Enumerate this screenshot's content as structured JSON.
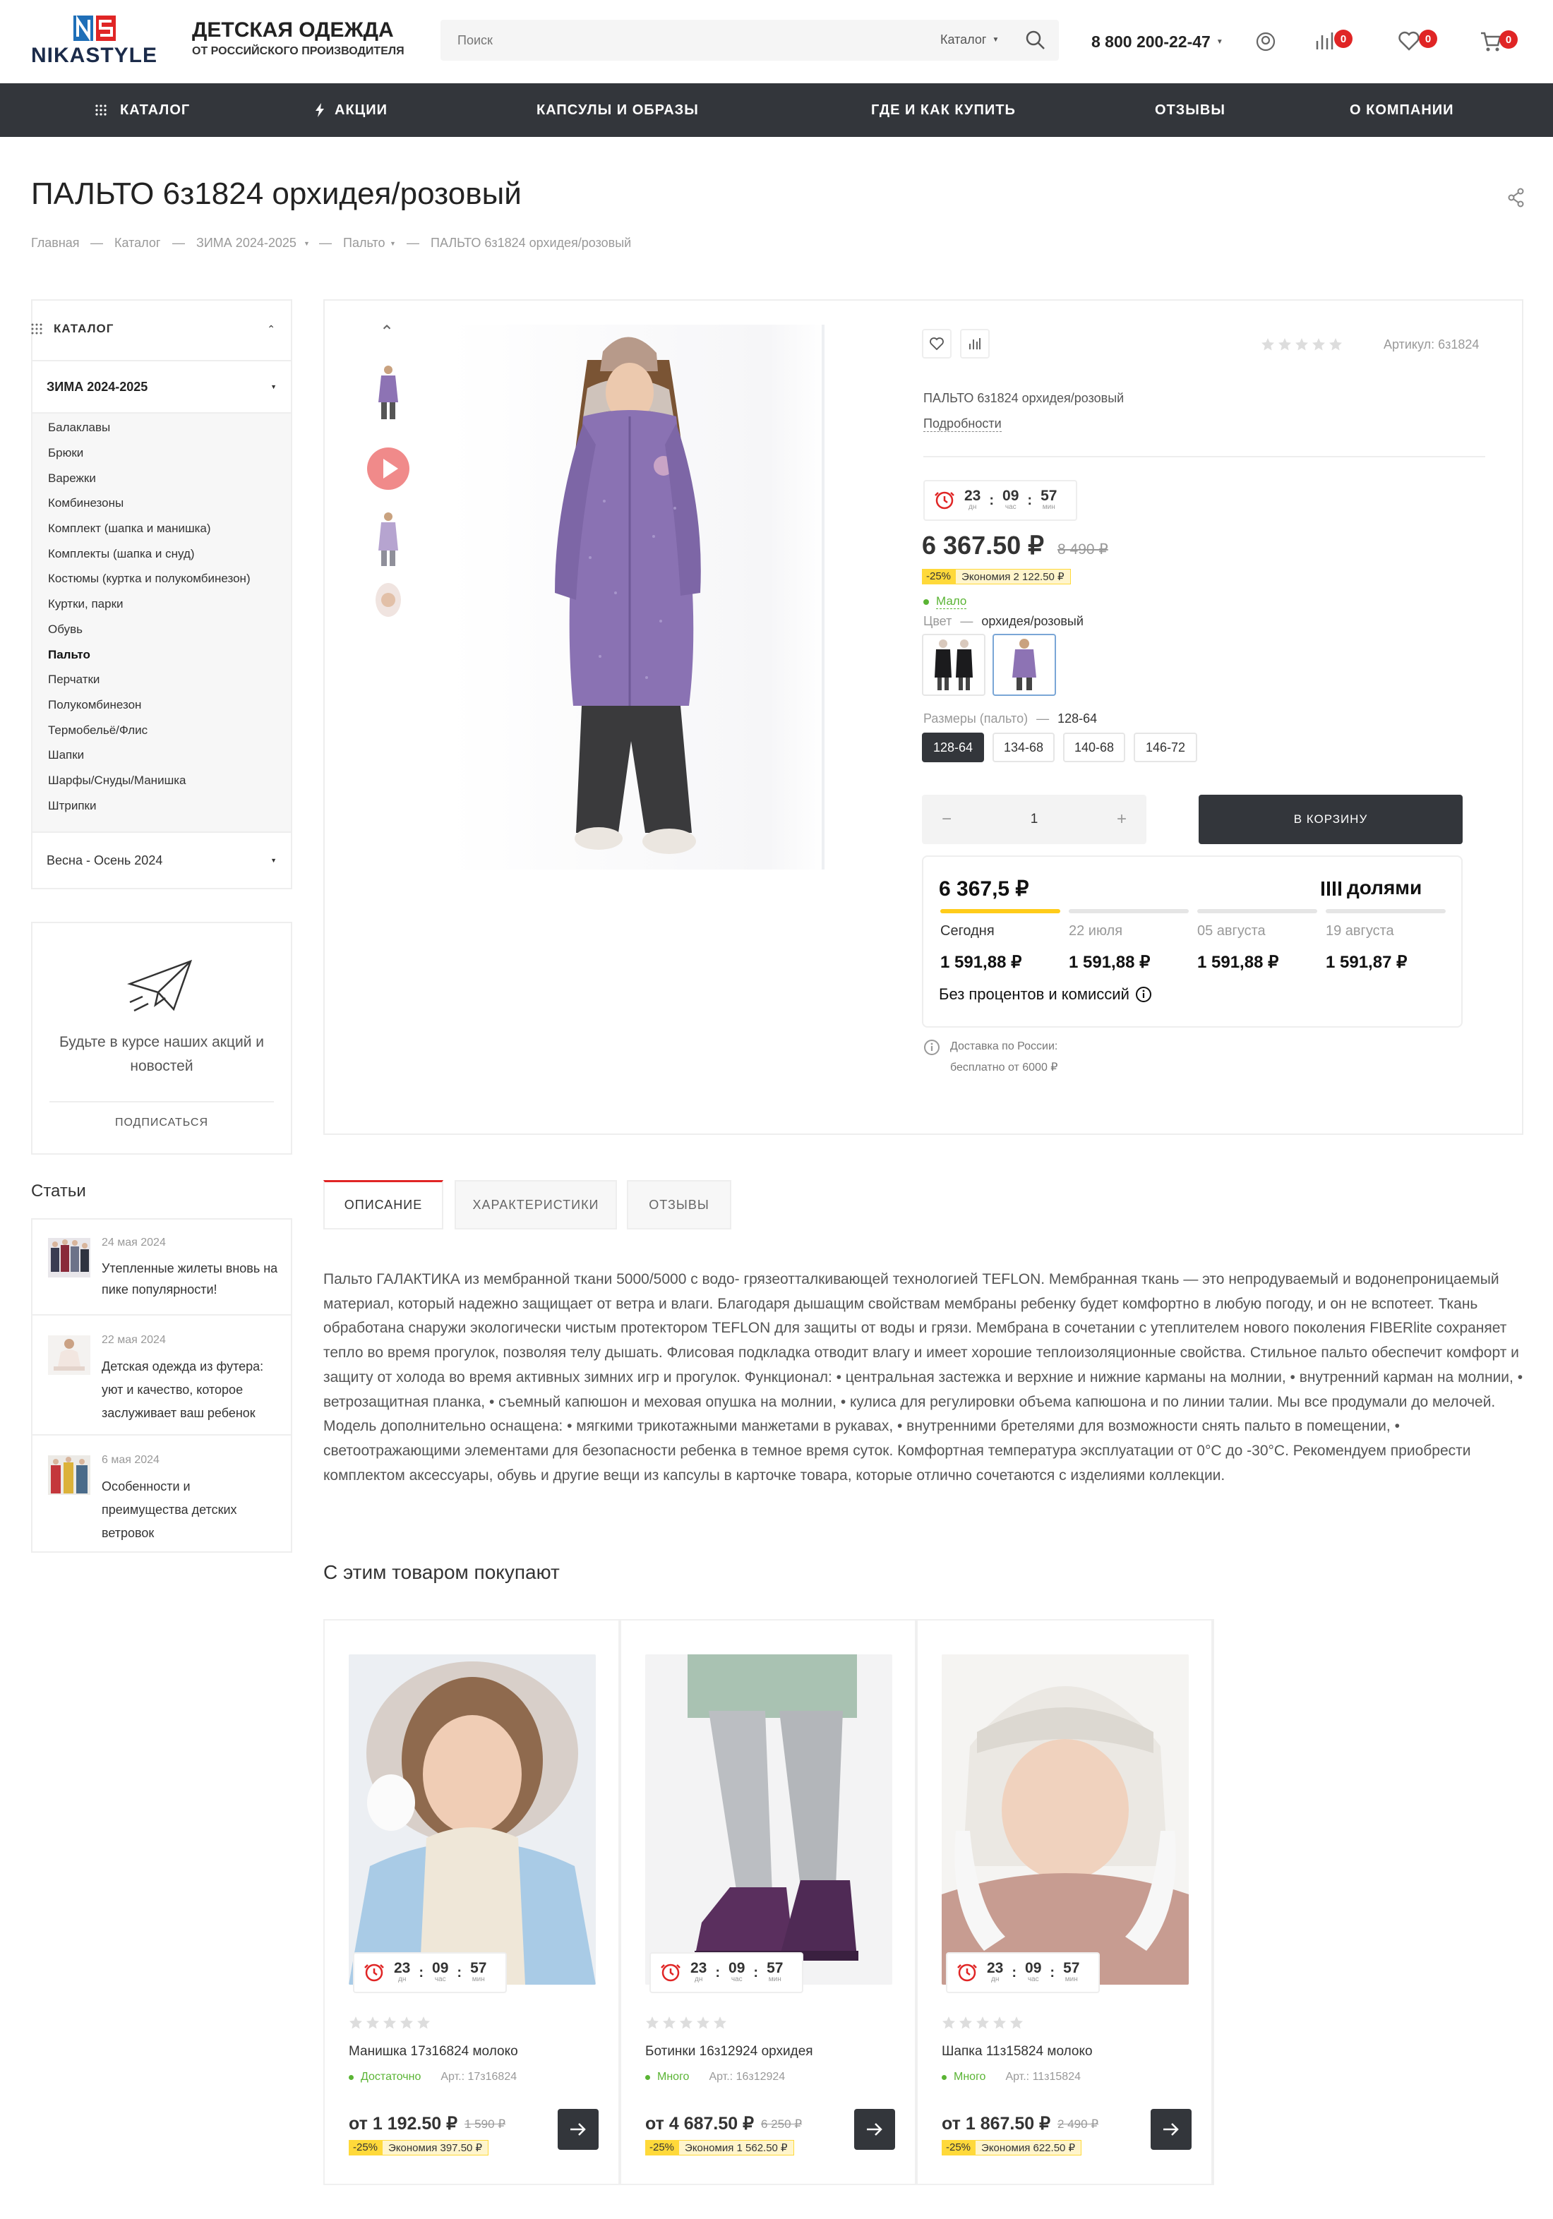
{
  "header": {
    "logo_text": "NIKASTYLE",
    "tagline_main": "ДЕТСКАЯ ОДЕЖДА",
    "tagline_sub": "ОТ РОССИЙСКОГО ПРОИЗВОДИТЕЛЯ",
    "search_placeholder": "Поиск",
    "search_scope": "Каталог",
    "phone": "8 800 200-22-47",
    "compare_count": "0",
    "favorites_count": "0",
    "cart_count": "0"
  },
  "nav": [
    "КАТАЛОГ",
    "АКЦИИ",
    "КАПСУЛЫ И ОБРАЗЫ",
    "ГДЕ И КАК КУПИТЬ",
    "ОТЗЫВЫ",
    "О КОМПАНИИ"
  ],
  "page_title": "ПАЛЬТО 6з1824 орхидея/розовый",
  "breadcrumbs": [
    "Главная",
    "Каталог",
    "ЗИМА 2024-2025",
    "Пальто",
    "ПАЛЬТО 6з1824 орхидея/розовый"
  ],
  "sidebar": {
    "catalog_title": "КАТАЛОГ",
    "section_open": "ЗИМА 2024-2025",
    "items": [
      "Балаклавы",
      "Брюки",
      "Варежки",
      "Комбинезоны",
      "Комплект (шапка и манишка)",
      "Комплекты (шапка и снуд)",
      "Костюмы (куртка и полукомбинезон)",
      "Куртки, парки",
      "Обувь",
      "Пальто",
      "Перчатки",
      "Полукомбинезон",
      "Термобельё/Флис",
      "Шапки",
      "Шарфы/Снуды/Манишка",
      "Штрипки"
    ],
    "active_item": "Пальто",
    "section_closed": "Весна - Осень 2024",
    "subscribe_text": "Будьте в курсе наших акций и новостей",
    "subscribe_button": "ПОДПИСАТЬСЯ",
    "articles_title": "Статьи",
    "articles": [
      {
        "date": "24 мая 2024",
        "title": "Утепленные жилеты вновь на пике популярности!"
      },
      {
        "date": "22 мая 2024",
        "title": "Детская одежда из футера: уют и качество, которое заслуживает ваш ребенок"
      },
      {
        "date": "6 мая 2024",
        "title": "Особенности и преимущества детских ветровок"
      }
    ]
  },
  "product": {
    "sku_label": "Артикул: 6з1824",
    "name_small": "ПАЛЬТО 6з1824 орхидея/розовый",
    "details_link": "Подробности",
    "timer": {
      "days": "23",
      "days_label": "дн",
      "hours": "09",
      "hours_label": "час",
      "mins": "57",
      "mins_label": "мин"
    },
    "price": "6 367.50 ₽",
    "old_price": "8 490 ₽",
    "discount": "-25%",
    "economy": "Экономия 2 122.50 ₽",
    "stock": "Мало",
    "color_label": "Цвет",
    "color_value": "орхидея/розовый",
    "size_label": "Размеры (пальто)",
    "size_value": "128-64",
    "sizes": [
      "128-64",
      "134-68",
      "140-68",
      "146-72"
    ],
    "qty": "1",
    "qty_minus": "−",
    "qty_plus": "+",
    "cart_button": "В КОРЗИНУ",
    "dolyami": {
      "total": "6 367,5 ₽",
      "brand": "долями",
      "payments": [
        {
          "date": "Сегодня",
          "sum": "1 591,88 ₽"
        },
        {
          "date": "22 июля",
          "sum": "1 591,88 ₽"
        },
        {
          "date": "05 августа",
          "sum": "1 591,88 ₽"
        },
        {
          "date": "19 августа",
          "sum": "1 591,87 ₽"
        }
      ],
      "note": "Без процентов и комиссий"
    },
    "delivery_line1": "Доставка по России:",
    "delivery_line2": "бесплатно от 6000 ₽"
  },
  "tabs": [
    "ОПИСАНИЕ",
    "ХАРАКТЕРИСТИКИ",
    "ОТЗЫВЫ"
  ],
  "description": "Пальто ГАЛАКТИКА из мембранной ткани 5000/5000 с водо- грязеотталкивающей технологией TEFLON. Мембранная ткань — это непродуваемый и водонепроницаемый материал, который надежно защищает от ветра и влаги. Благодаря дышащим свойствам мембраны ребенку будет комфортно в любую погоду, и он не вспотеет. Ткань обработана снаружи экологически чистым протектором TEFLON для защиты от воды и грязи. Мембрана в сочетании с утеплителем нового поколения FIBERlite сохраняет тепло во время прогулок, позволяя телу дышать. Флисовая подкладка отводит влагу и имеет хорошие теплоизоляционные свойства. Стильное пальто обеспечит комфорт и защиту от холода во время активных зимних игр и прогулок. Функционал: • центральная застежка и верхние и нижние карманы на молнии, • внутренний карман на молнии, • ветрозащитная планка, • съемный капюшон и меховая опушка на молнии, • кулиса для регулировки объема капюшона и по линии талии. Мы все продумали до мелочей. Модель дополнительно оснащена: • мягкими трикотажными манжетами в рукавах, • внутренними бретелями для возможности снять пальто в помещении, • светоотражающими элементами для безопасности ребенка в темное время суток. Комфортная температура эксплуатации от 0°C до -30°C. Рекомендуем приобрести комплектом аксессуары, обувь и другие вещи из капсулы в карточке товара, которые отлично сочетаются с изделиями коллекции.",
  "related_title": "С этим товаром покупают",
  "related": [
    {
      "name": "Манишка 17з16824 молоко",
      "stock": "Достаточно",
      "art": "Арт.: 17з16824",
      "price": "от 1 192.50 ₽",
      "old": "1 590 ₽",
      "discount": "-25%",
      "economy": "Экономия 397.50 ₽"
    },
    {
      "name": "Ботинки 16з12924 орхидея",
      "stock": "Много",
      "art": "Арт.: 16з12924",
      "price": "от 4 687.50 ₽",
      "old": "6 250 ₽",
      "discount": "-25%",
      "economy": "Экономия 1 562.50 ₽"
    },
    {
      "name": "Шапка 11з15824 молоко",
      "stock": "Много",
      "art": "Арт.: 11з15824",
      "price": "от 1 867.50 ₽",
      "old": "2 490 ₽",
      "discount": "-25%",
      "economy": "Экономия 622.50 ₽"
    }
  ],
  "colors": {
    "nav_bg": "#33363b",
    "accent_red": "#e02525",
    "logo_blue": "#1f6fb8",
    "stock_green": "#5ab434",
    "discount_yellow": "#ffd93a"
  }
}
